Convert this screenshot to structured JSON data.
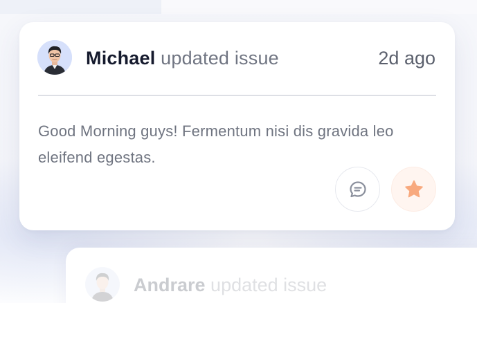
{
  "feed": {
    "primary": {
      "user": "Michael",
      "action": "updated issue",
      "time": "2d ago",
      "message": "Good Morning guys! Fermentum nisi dis gravida leo eleifend egestas.",
      "actions": [
        {
          "icon": "comment-icon"
        },
        {
          "icon": "star-icon"
        }
      ]
    },
    "secondary": {
      "user": "Andrare",
      "action": "updated issue"
    }
  },
  "colors": {
    "accent_star": "#f8a97e",
    "name_text": "#151a2d",
    "muted_text": "#707582",
    "divider": "#dddfe5"
  }
}
